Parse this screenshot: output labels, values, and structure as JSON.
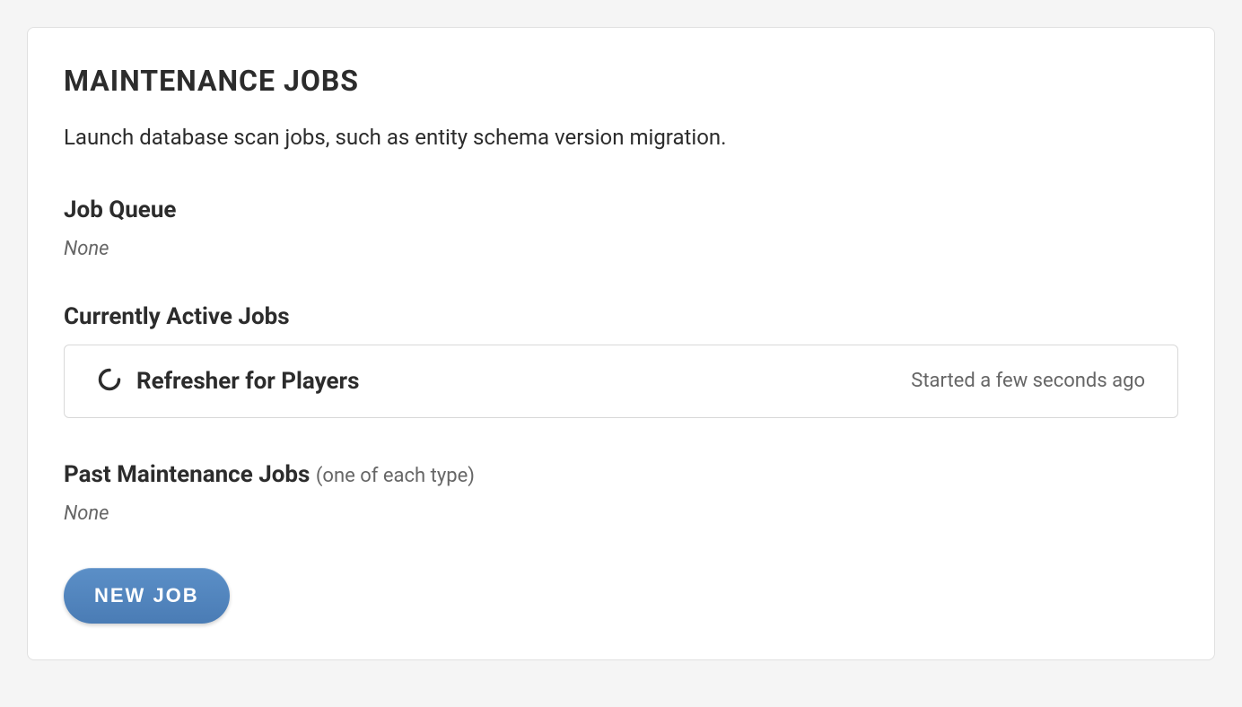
{
  "title": "MAINTENANCE JOBS",
  "description": "Launch database scan jobs, such as entity schema version migration.",
  "sections": {
    "queue": {
      "heading": "Job Queue",
      "empty": "None"
    },
    "active": {
      "heading": "Currently Active Jobs",
      "jobs": [
        {
          "name": "Refresher for Players",
          "status": "Started a few seconds ago"
        }
      ]
    },
    "past": {
      "heading": "Past Maintenance Jobs",
      "subtext": "(one of each type)",
      "empty": "None"
    }
  },
  "buttons": {
    "new_job": "NEW JOB"
  }
}
